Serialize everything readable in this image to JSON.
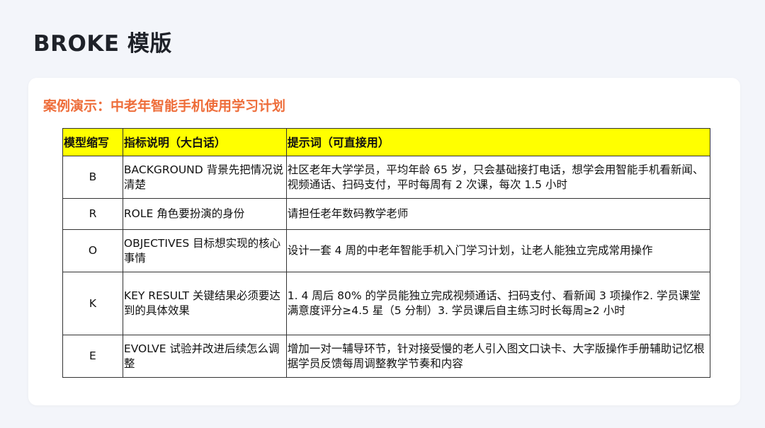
{
  "page": {
    "title": "BROKE 模版"
  },
  "card": {
    "case_title": "案例演示：中老年智能手机使用学习计划"
  },
  "table": {
    "headers": [
      "模型缩写",
      "指标说明（大白话）",
      "提示词（可直接用）"
    ],
    "rows": [
      {
        "abbr": "B",
        "desc": "BACKGROUND 背景先把情况说清楚",
        "prompt": "社区老年大学学员，平均年龄 65 岁，只会基础接打电话，想学会用智能手机看新闻、视频通话、扫码支付，平时每周有 2 次课，每次 1.5 小时"
      },
      {
        "abbr": "R",
        "desc": "ROLE 角色要扮演的身份",
        "prompt": "请担任老年数码教学老师"
      },
      {
        "abbr": "O",
        "desc": "OBJECTIVES 目标想实现的核心事情",
        "prompt": "设计一套 4 周的中老年智能手机入门学习计划，让老人能独立完成常用操作"
      },
      {
        "abbr": "K",
        "desc": "KEY RESULT 关键结果必须要达到的具体效果",
        "prompt": "1. 4 周后 80% 的学员能独立完成视频通话、扫码支付、看新闻 3 项操作2. 学员课堂满意度评分≥4.5 星（5 分制）3. 学员课后自主练习时长每周≥2 小时"
      },
      {
        "abbr": "E",
        "desc": "EVOLVE 试验并改进后续怎么调整",
        "prompt": "增加一对一辅导环节，针对接受慢的老人引入图文口诀卡、大字版操作手册辅助记忆根据学员反馈每周调整教学节奏和内容"
      }
    ]
  },
  "colors": {
    "page_background": "#f3f5fa",
    "card_background": "#ffffff",
    "case_title": "#ee6d3a",
    "header_fill": "#ffff00"
  }
}
